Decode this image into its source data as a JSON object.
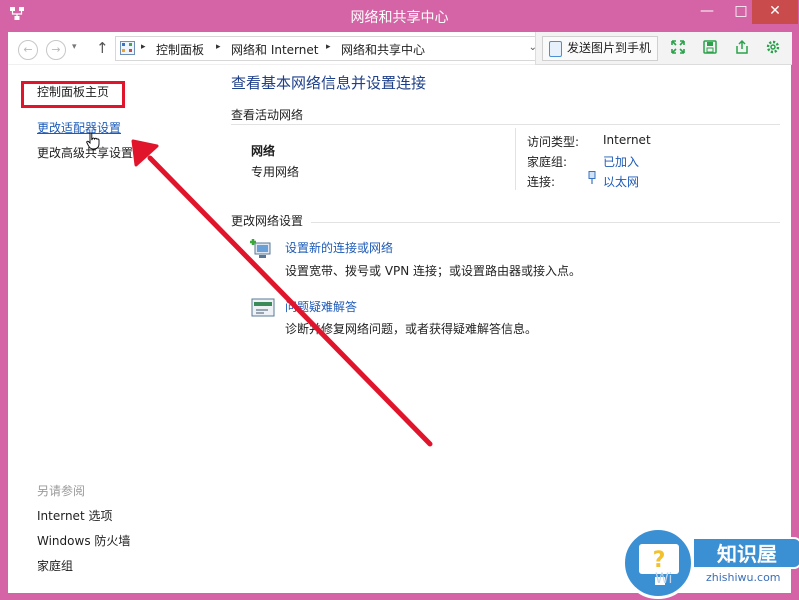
{
  "window": {
    "title": "网络和共享中心",
    "controls": {
      "minimize": "—",
      "maximize": "□",
      "close": "✕"
    }
  },
  "address_bar": {
    "back": "←",
    "forward": "→",
    "up": "↑",
    "crumbs": [
      "控制面板",
      "网络和 Internet",
      "网络和共享中心"
    ],
    "separator": "▸",
    "dropdown": "⌄"
  },
  "toolbar": {
    "send_to_phone": "发送图片到手机",
    "icons": [
      "fullscreen-icon",
      "save-icon",
      "share-icon",
      "settings-icon"
    ],
    "icon_color": "#2aa14a"
  },
  "left_pane": {
    "home_link": "控制面板主页",
    "adapter_link": "更改适配器设置",
    "sharing_link": "更改高级共享设置",
    "see_also_label": "另请参阅",
    "see_also": [
      "Internet 选项",
      "Windows 防火墙",
      "家庭组"
    ]
  },
  "main": {
    "title": "查看基本网络信息并设置连接",
    "active_networks_heading": "查看活动网络",
    "network_name": "网络",
    "network_category": "专用网络",
    "access_type_label": "访问类型:",
    "access_type_value": "Internet",
    "homegroup_label": "家庭组:",
    "homegroup_value": "已加入",
    "connection_label": "连接:",
    "connection_value": "以太网",
    "change_settings_heading": "更改网络设置",
    "tasks": [
      {
        "link": "设置新的连接或网络",
        "desc": "设置宽带、拨号或 VPN 连接；或设置路由器或接入点。"
      },
      {
        "link": "问题疑难解答",
        "desc": "诊断并修复网络问题，或者获得疑难解答信息。"
      }
    ]
  },
  "annotation": {
    "color": "#e0142b"
  },
  "watermark": {
    "title": "知识屋",
    "site": "zhishiwu.com",
    "faded": "Wi",
    "badge_color": "#3b90d4"
  },
  "colors": {
    "frame": "#d564a6",
    "link": "#1e5bb7",
    "title": "#1e3f8a"
  }
}
